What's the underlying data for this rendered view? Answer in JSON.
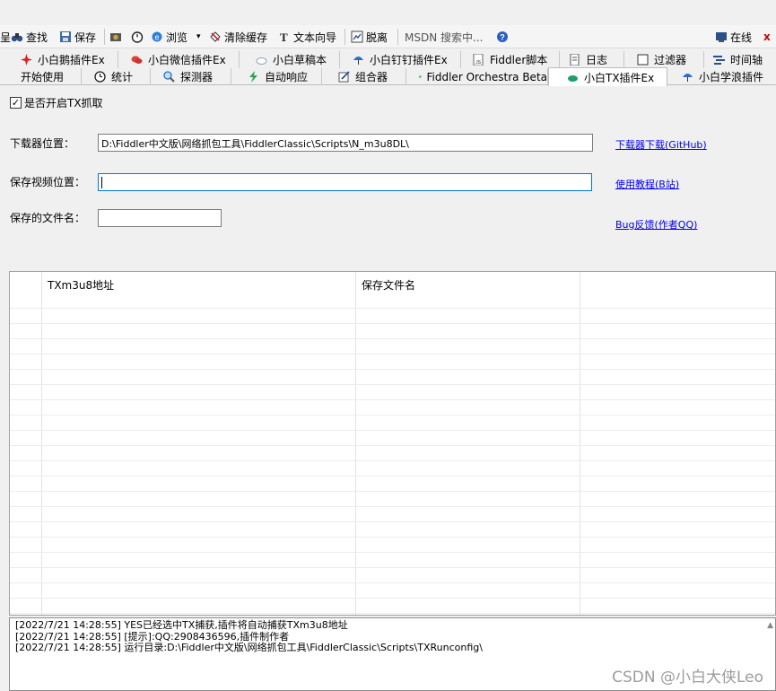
{
  "toolbar": {
    "items": [
      {
        "label": "呈",
        "icon": "partial-icon"
      },
      {
        "label": "查找",
        "icon": "binoculars-icon"
      },
      {
        "label": "保存",
        "icon": "save-icon"
      },
      {
        "label": "",
        "icon": "camera-icon"
      },
      {
        "label": "",
        "icon": "timer-icon"
      },
      {
        "label": "浏览",
        "icon": "browser-e-icon"
      },
      {
        "label": "清除缓存",
        "icon": "clear-cache-icon"
      },
      {
        "label": "文本向导",
        "icon": "text-wizard-icon"
      },
      {
        "label": "脱离",
        "icon": "detach-icon"
      },
      {
        "label": "MSDN 搜索中...",
        "icon": ""
      },
      {
        "label": "",
        "icon": "help-icon"
      },
      {
        "label": "在线",
        "icon": "online-icon"
      },
      {
        "label": "x",
        "icon": ""
      }
    ]
  },
  "tabs_row1": [
    {
      "label": "小白鹅插件Ex",
      "icon": "star-red-icon"
    },
    {
      "label": "小白微信插件Ex",
      "icon": "wechat-icon"
    },
    {
      "label": "小白草稿本",
      "icon": "cloud-icon"
    },
    {
      "label": "小白钉钉插件Ex",
      "icon": "umbrella-icon"
    },
    {
      "label": "Fiddler脚本",
      "icon": "js-icon"
    },
    {
      "label": "日志",
      "icon": "log-icon"
    },
    {
      "label": "过滤器",
      "icon": "checkbox-icon"
    },
    {
      "label": "时间轴",
      "icon": "timeline-icon"
    }
  ],
  "tabs_row2": [
    {
      "label": "开始使用",
      "icon": ""
    },
    {
      "label": "统计",
      "icon": "clock-icon"
    },
    {
      "label": "探测器",
      "icon": "magnifier-icon"
    },
    {
      "label": "自动响应",
      "icon": "lightning-icon"
    },
    {
      "label": "组合器",
      "icon": "composer-icon"
    },
    {
      "label": "Fiddler Orchestra Beta",
      "icon": "fo-icon"
    },
    {
      "label": "小白TX插件Ex",
      "icon": "tx-icon"
    },
    {
      "label": "小白学浪插件",
      "icon": "umbrella-icon"
    }
  ],
  "panel": {
    "enable_tx_label": "是否开启TX抓取",
    "downloader_label": "下载器位置：",
    "downloader_value": "D:\\Fiddler中文版\\网络抓包工具\\FiddlerClassic\\Scripts\\N_m3u8DL\\",
    "save_video_label": "保存视频位置：",
    "save_video_value": "",
    "save_filename_label": "保存的文件名：",
    "save_filename_value": "",
    "link_download": "下载器下载(GitHub)",
    "link_tutorial": "使用教程(B站)",
    "link_bug": "Bug反馈(作者QQ)"
  },
  "grid": {
    "columns": [
      "TXm3u8地址",
      "保存文件名"
    ],
    "rows": []
  },
  "log": {
    "lines": [
      "[2022/7/21 14:28:55] YES已经选中TX捕获,插件将自动捕获TXm3u8地址",
      "[2022/7/21 14:28:55] [提示]:QQ:2908436596,插件制作者",
      "[2022/7/21 14:28:55] 运行目录:D:\\Fiddler中文版\\网络抓包工具\\FiddlerClassic\\Scripts\\TXRunconfig\\"
    ]
  },
  "watermark": "CSDN @小白大侠Leo",
  "colors": {
    "link": "#0000ee",
    "focus_border": "#0078d7",
    "panel_bg": "#f0f0f0"
  }
}
